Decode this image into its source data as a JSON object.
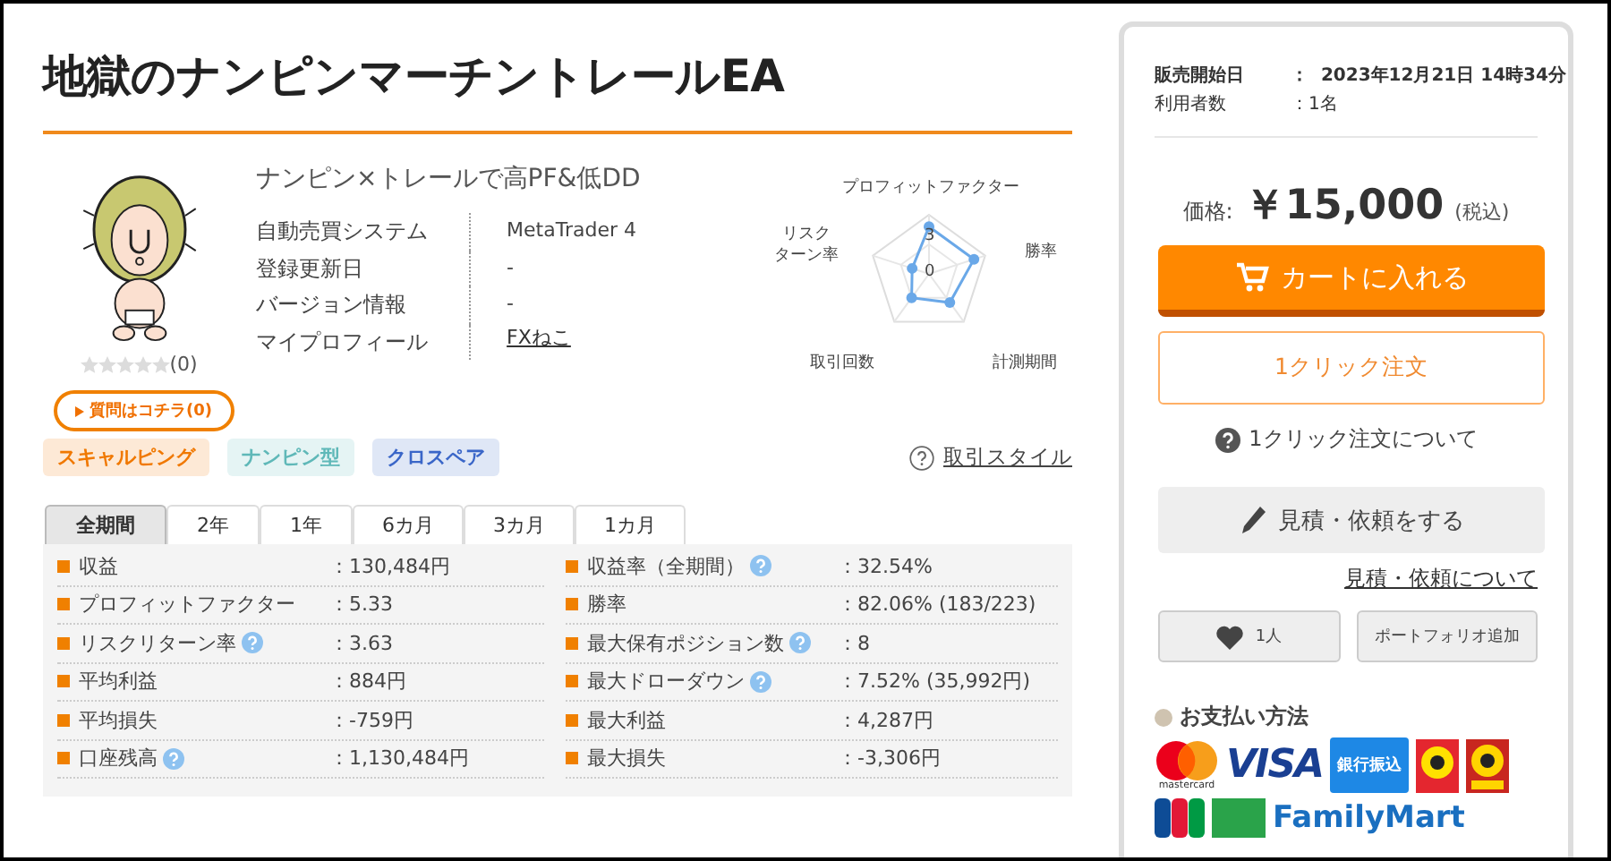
{
  "title": "地獄のナンピンマーチントレールEA",
  "product": {
    "catchcopy": "ナンピン×トレールで高PF&低DD",
    "specs": [
      {
        "label": "自動売買システム",
        "value": "MetaTrader 4",
        "kind": "text"
      },
      {
        "label": "登録更新日",
        "value": "-",
        "kind": "text"
      },
      {
        "label": "バージョン情報",
        "value": "-",
        "kind": "text"
      },
      {
        "label": "マイプロフィール",
        "value": "FXねこ",
        "kind": "link"
      }
    ],
    "stars": 0,
    "review_count": "(0)",
    "question_button": "質問はコチラ(0)"
  },
  "radar": {
    "axes": [
      {
        "lines": [
          "プロフィットファクター"
        ]
      },
      {
        "lines": [
          "勝率"
        ]
      },
      {
        "lines": [
          "計測期間"
        ]
      },
      {
        "lines": [
          "取引回数"
        ]
      },
      {
        "lines": [
          "リスク",
          "ターン率"
        ]
      }
    ],
    "scale_labels": [
      "3",
      "0"
    ]
  },
  "tags": [
    {
      "label": "スキャルピング",
      "color": "#f07800"
    },
    {
      "label": "ナンピン型",
      "color": "#5fb8b8"
    },
    {
      "label": "クロスペア",
      "color": "#3a66c8"
    }
  ],
  "trade_style_link": "取引スタイル",
  "period_tabs": [
    {
      "label": "全期間",
      "selected": true
    },
    {
      "label": "2年",
      "selected": false
    },
    {
      "label": "1年",
      "selected": false
    },
    {
      "label": "6カ月",
      "selected": false
    },
    {
      "label": "3カ月",
      "selected": false
    },
    {
      "label": "1カ月",
      "selected": false
    }
  ],
  "stats": [
    {
      "label": "収益",
      "value": "：130,484円",
      "help": false
    },
    {
      "label": "収益率（全期間）",
      "value": "：32.54%",
      "help": true
    },
    {
      "label": "プロフィットファクター",
      "value": "：5.33",
      "help": false
    },
    {
      "label": "勝率",
      "value": "：82.06% (183/223)",
      "help": false
    },
    {
      "label": "リスクリターン率",
      "value": "：3.63",
      "help": true
    },
    {
      "label": "最大保有ポジション数",
      "value": "：8",
      "help": true
    },
    {
      "label": "平均利益",
      "value": "：884円",
      "help": false
    },
    {
      "label": "最大ドローダウン",
      "value": "：7.52% (35,992円)",
      "help": true
    },
    {
      "label": "平均損失",
      "value": "：-759円",
      "help": false
    },
    {
      "label": "最大利益",
      "value": "：4,287円",
      "help": false
    },
    {
      "label": "口座残高",
      "value": "：1,130,484円",
      "help": true
    },
    {
      "label": "最大損失",
      "value": "：-3,306円",
      "help": false
    }
  ],
  "sidebar": {
    "sale_info": [
      {
        "label": "販売開始日",
        "value": "：  2023年12月21日 14時34分",
        "bold": true
      },
      {
        "label": "利用者数",
        "value": "：1名",
        "bold": false
      }
    ],
    "price": {
      "label": "価格:",
      "amount": "￥15,000",
      "tax": "(税込)"
    },
    "cart_button": "カートに入れる",
    "one_click_button": "1クリック注文",
    "one_click_help": "1クリック注文について",
    "estimate_button": "見積・依頼をする",
    "estimate_link": "見積・依頼について",
    "favorite_count": "1人",
    "portfolio_button": "ポートフォリオ追加",
    "payment": {
      "heading": "お支払い方法",
      "methods": [
        {
          "kind": "mastercard",
          "label": "mastercard"
        },
        {
          "kind": "visa",
          "label": "VISA"
        },
        {
          "kind": "bank",
          "label": "銀行振込"
        },
        {
          "kind": "pay-easy"
        },
        {
          "kind": "daily"
        },
        {
          "kind": "jcb"
        },
        {
          "kind": "green"
        },
        {
          "kind": "familymart",
          "label": "FamilyMart"
        }
      ]
    }
  }
}
